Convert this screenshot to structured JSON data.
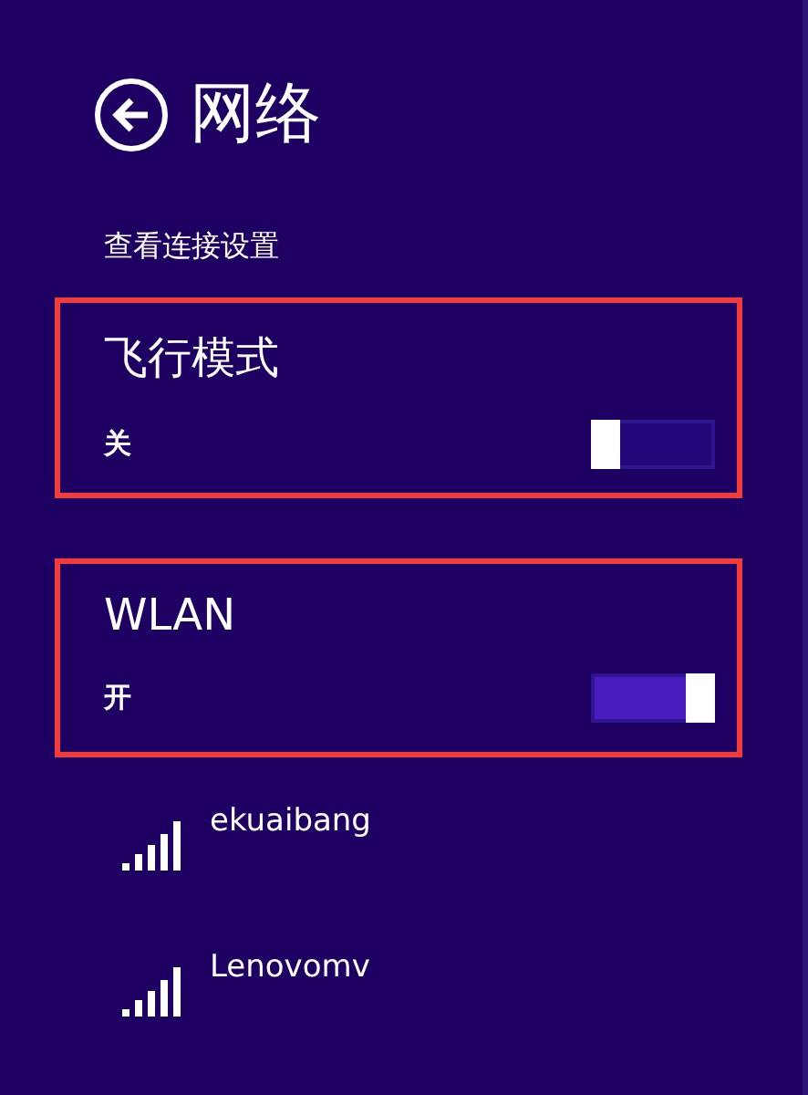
{
  "header": {
    "title": "网络"
  },
  "subtitle": "查看连接设置",
  "settings": [
    {
      "label": "飞行模式",
      "state_text": "关",
      "on": false,
      "highlighted": true
    },
    {
      "label": "WLAN",
      "state_text": "开",
      "on": true,
      "highlighted": true
    }
  ],
  "networks": [
    {
      "name": "ekuaibang"
    },
    {
      "name": "Lenovomv"
    }
  ]
}
